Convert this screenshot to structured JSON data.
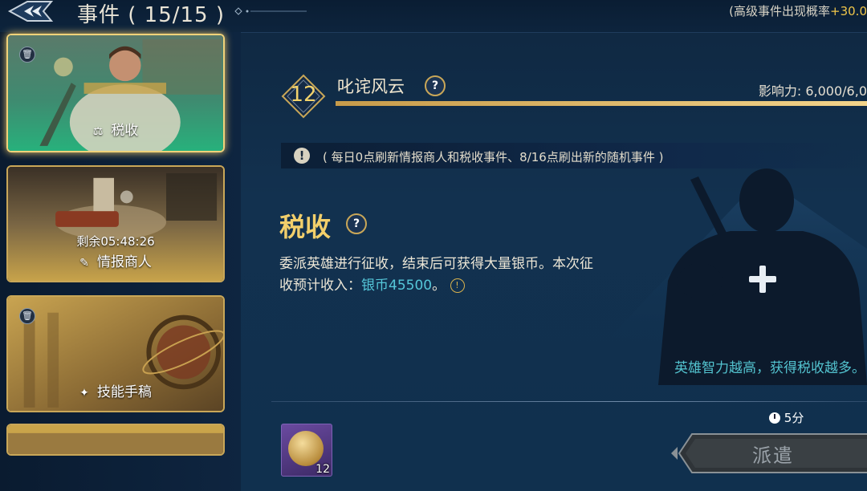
{
  "header": {
    "title": "事件 ( 15/15 )",
    "rate_label": "(高级事件出现概率",
    "rate_value": "+30.0"
  },
  "sidebar": {
    "cards": [
      {
        "label": "税收",
        "selected": true
      },
      {
        "label": "情报商人",
        "timer": "剩余05:48:26"
      },
      {
        "label": "技能手稿"
      }
    ]
  },
  "event": {
    "level": "12",
    "name": "叱诧风云",
    "influence_label": "影响力:",
    "influence_value": "6,000/6,0",
    "influence_progress": 1.0
  },
  "notice": "( 每日0点刷新情报商人和税收事件、8/16点刷出新的随机事件 )",
  "detail": {
    "title": "税收",
    "desc_part1": "委派英雄进行征收，结束后可获得大量银币。本次征收预计收入：",
    "silver": "银币45500",
    "desc_part2": "。",
    "hero_hint": "英雄智力越高，获得税收越多。"
  },
  "footer": {
    "duration": "5分",
    "reward_count": "12",
    "dispatch_label": "派遣"
  },
  "colors": {
    "accent_gold": "#f2cf6b",
    "teal": "#53c3cf",
    "silver_text": "#55c7d9"
  }
}
